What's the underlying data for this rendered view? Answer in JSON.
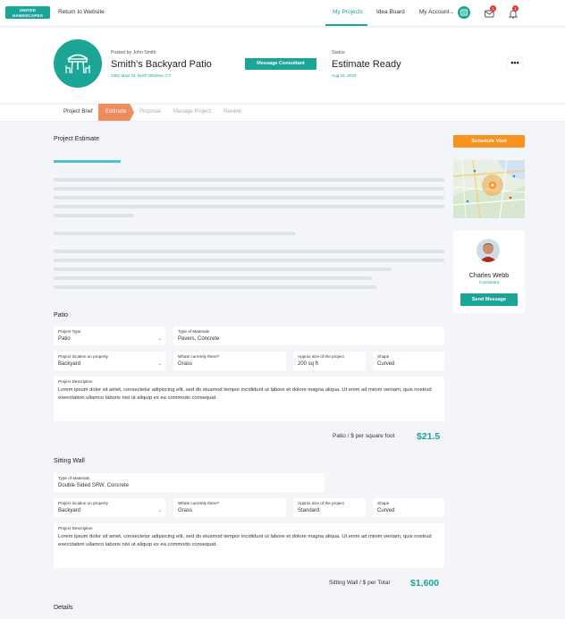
{
  "nav": {
    "logo_line1": "UNITED",
    "logo_line2": "HANDSCAPES",
    "return_link": "Return to Website",
    "my_projects": "My Projects",
    "idea_board": "Idea Board",
    "my_account": "My Account",
    "messages_count": "1",
    "notifications_count": "1"
  },
  "header": {
    "posted_by": "Posted by John Smith",
    "title": "Smith's Backyard Patio",
    "address": "2351 Main St, North Windsor, CT",
    "message_button": "Message Consultant",
    "status_label": "Status",
    "status_value": "Estimate Ready",
    "status_date": "Aug 15, 2020",
    "more_label": "•••"
  },
  "tabs": [
    {
      "label": "Project Brief",
      "state": "done"
    },
    {
      "label": "Estimate",
      "state": "active"
    },
    {
      "label": "Proposal",
      "state": "todo"
    },
    {
      "label": "Manage Project",
      "state": "todo"
    },
    {
      "label": "Review",
      "state": "todo"
    }
  ],
  "estimate": {
    "title": "Project Estimate"
  },
  "patio": {
    "title": "Patio",
    "project_type_label": "Project Type",
    "project_type_value": "Patio",
    "materials_label": "Type of Materials",
    "materials_value": "Pavers, Concrete",
    "location_label": "Project location on property",
    "location_value": "Backyard",
    "currently_label": "Whats currently there?",
    "currently_value": "Grass",
    "size_label": "Approx size of the project",
    "size_value": "200 sq ft",
    "shape_label": "Shape",
    "shape_value": "Curved",
    "description_label": "Project Description",
    "description_value": "Lorem ipsum dolor sit amet, consectetur adipiscing elit, sed do eiusmod tempor incididunt ut labore et dolore magna aliqua. Ut enim ad minim veniam, quis nostrud exercitation ullamco laboris nisi ut aliquip ex ea commodo consequat.",
    "price_label": "Patio / $ per square foot",
    "price_value": "$21.5"
  },
  "wall": {
    "title": "Sitting Wall",
    "materials_label": "Type of Materials",
    "materials_value": "Double Sided SRW, Concrete",
    "location_label": "Project location on property",
    "location_value": "Backyard",
    "currently_label": "Whats currently there?",
    "currently_value": "Grass",
    "size_label": "Approx size of the project",
    "size_value": "Standard",
    "shape_label": "Shape",
    "shape_value": "Curved",
    "description_label": "Project Description",
    "description_value": "Lorem ipsum dolor sit amet, consectetur adipiscing elit, sed do eiusmod tempor incididunt ut labore et dolore magna aliqua. Ut enim ad minim veniam, quis nostrud exercitation ullamco laboris nisi ut aliquip ex ea commodo consequat.",
    "price_label": "Sitting Wall / $ per Total",
    "price_value": "$1,600"
  },
  "details": {
    "title": "Details"
  },
  "sidebar": {
    "schedule_button": "Schedule Visit",
    "consultant_name": "Charles Webb",
    "consultant_role": "Consultant",
    "send_button": "Send Message"
  },
  "colors": {
    "teal": "#1ba597",
    "orange": "#f7931e",
    "active_tab": "#f08b5f",
    "badge": "#e53935"
  }
}
